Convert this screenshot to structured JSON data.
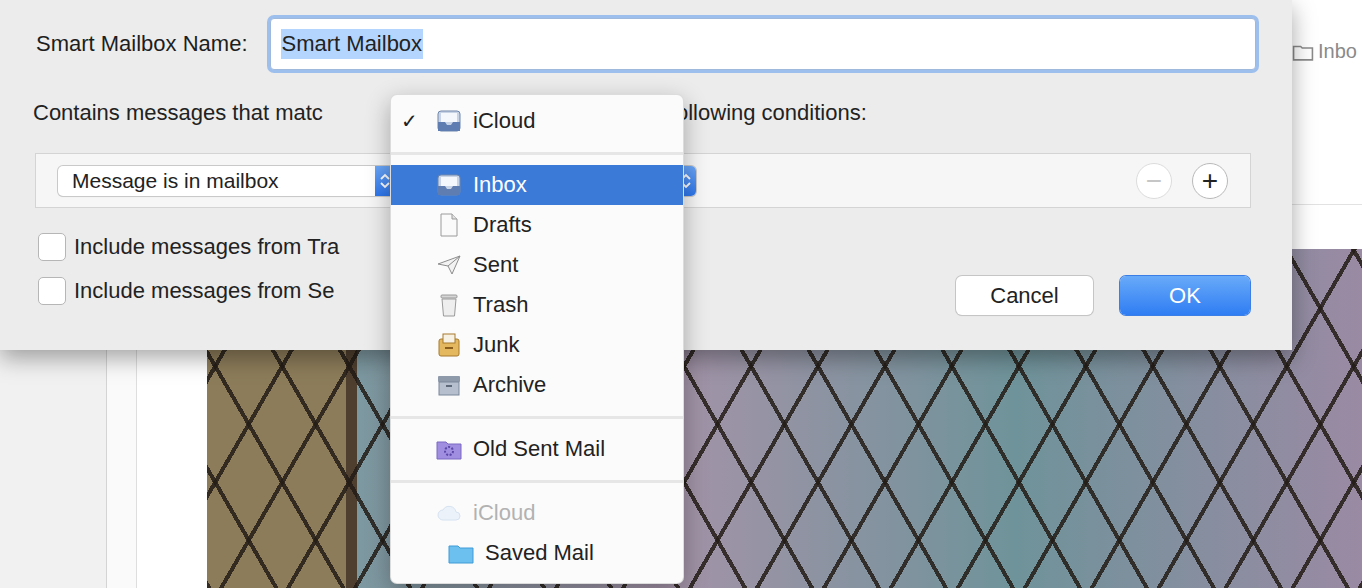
{
  "background": {
    "tab_label": "Inbo"
  },
  "dialog": {
    "name_label": "Smart Mailbox Name:",
    "name_value": "Smart Mailbox",
    "name_selected": true,
    "match_label_start": "Contains messages that matc",
    "match_label_end": "ollowing conditions:",
    "conditions": [
      {
        "field": "Message is in mailbox"
      }
    ],
    "remove_button": {
      "symbol": "−",
      "disabled": true
    },
    "add_button": {
      "symbol": "+",
      "disabled": false
    },
    "checkboxes": [
      {
        "label": "Include messages from Tra",
        "checked": false
      },
      {
        "label": "Include messages from Se",
        "checked": false
      }
    ],
    "buttons": [
      {
        "label": "Cancel",
        "default": false
      },
      {
        "label": "OK",
        "default": true
      }
    ]
  },
  "menu": {
    "mark": "✓",
    "items": [
      {
        "kind": "item",
        "label": "iCloud",
        "checked": true,
        "selected": false,
        "disabled": false
      },
      {
        "kind": "separator"
      },
      {
        "kind": "item",
        "label": "Inbox",
        "checked": false,
        "selected": true,
        "disabled": false
      },
      {
        "kind": "item",
        "label": "Drafts",
        "checked": false,
        "selected": false,
        "disabled": false
      },
      {
        "kind": "item",
        "label": "Sent",
        "checked": false,
        "selected": false,
        "disabled": false
      },
      {
        "kind": "item",
        "label": "Trash",
        "checked": false,
        "selected": false,
        "disabled": false
      },
      {
        "kind": "item",
        "label": "Junk",
        "checked": false,
        "selected": false,
        "disabled": false
      },
      {
        "kind": "item",
        "label": "Archive",
        "checked": false,
        "selected": false,
        "disabled": false
      },
      {
        "kind": "separator"
      },
      {
        "kind": "item",
        "label": "Old Sent Mail",
        "checked": false,
        "selected": false,
        "disabled": false
      },
      {
        "kind": "separator"
      },
      {
        "kind": "header",
        "label": "iCloud",
        "checked": false,
        "selected": false,
        "disabled": true
      },
      {
        "kind": "subitem",
        "label": "Saved Mail",
        "checked": false,
        "selected": false,
        "disabled": false
      }
    ]
  }
}
